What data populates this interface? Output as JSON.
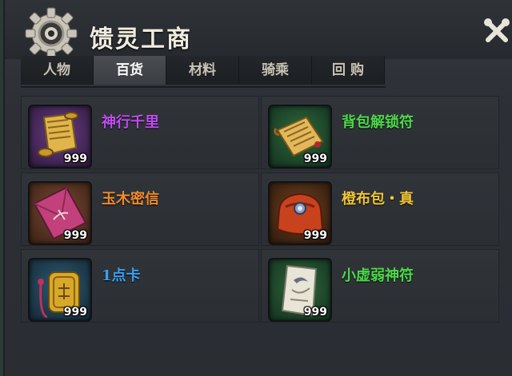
{
  "shop": {
    "title": "馈灵工商",
    "tabs": [
      {
        "label": "人物",
        "active": false
      },
      {
        "label": "百货",
        "active": true
      },
      {
        "label": "材料",
        "active": false
      },
      {
        "label": "骑乘",
        "active": false
      },
      {
        "label": "回 购",
        "active": false
      }
    ],
    "items": [
      {
        "name": "神行千里",
        "count": "999",
        "name_color": "#c04cf0",
        "icon": "scroll-icon",
        "slot_color": "#4b2a63"
      },
      {
        "name": "背包解锁符",
        "count": "999",
        "name_color": "#4cd94a",
        "icon": "unlock-scroll-icon",
        "slot_color": "#1f4a2a"
      },
      {
        "name": "玉木密信",
        "count": "999",
        "name_color": "#f08a2c",
        "icon": "envelope-icon",
        "slot_color": "#5a3524"
      },
      {
        "name": "橙布包・真",
        "count": "999",
        "name_color": "#f0c43a",
        "icon": "bag-icon",
        "slot_color": "#5a3520"
      },
      {
        "name": "1点卡",
        "count": "999",
        "name_color": "#3aa0f0",
        "icon": "token-icon",
        "slot_color": "#1f3d52"
      },
      {
        "name": "小虚弱神符",
        "count": "999",
        "name_color": "#4cd94a",
        "icon": "talisman-icon",
        "slot_color": "#1f4a2a"
      }
    ]
  }
}
